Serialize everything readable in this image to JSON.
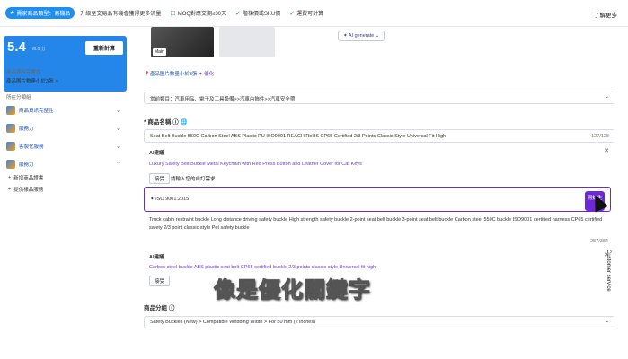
{
  "topbar": {
    "badge": "賣家商品類型：商機品",
    "items": [
      "升級至交易品有機會獲得更多流量",
      "MOQ對應交期≤30天",
      "階梯價或SKU價",
      "運費可計算"
    ],
    "calc_label": "了解更多"
  },
  "sidebar": {
    "score": "5.4",
    "score_sub": "/8.0 分",
    "recalc_label": "重新計算",
    "label1": "商品資料完整性",
    "label2": "產品圖片數量小於3張",
    "section_label": "所在分類組",
    "categories": [
      {
        "label": "商品資訊完整性"
      },
      {
        "label": "服務力"
      },
      {
        "label": "客製化服務"
      },
      {
        "label": "服務力"
      }
    ],
    "subitems": [
      "新增商品證書",
      "提供樣品服務"
    ]
  },
  "main": {
    "img_main_label": "Main",
    "ai_generate_label": "AI generate",
    "image_hint": "產品圖片數量小於3張",
    "image_hint_action": "優化",
    "category_path": "當前類目：汽車用品、電子及工具設備>>汽車內飾件>>汽車安全帶",
    "product_name_label": "* 商品名稱",
    "product_name_value": "Seat Belt Buckle 550C Carbon Steel ABS Plastic PU ISO9001 REACH RoHS CP65 Certified 2/3 Points Classic Style Universal Fit High",
    "product_name_count": "127/128",
    "ai1_title": "AI建議",
    "ai1_text": "Luxury Safety Belt Buckle Metal Keychain with Red Press Button and Leather Cover for Car Keys",
    "accept_label": "接受",
    "custom_label": "請輸入您的自訂需求",
    "input_value": "ISO 9001:2015",
    "start_label": "開始生",
    "keywords_value": "Truck cabin restraint buckle Long distance driving safety buckle High strength safety buckle 2-point seat belt buckle 3-point seat belt buckle Carbon steel 550C buckle ISO9001 certified harness CP65 certified safety 2/3 point classic style Pet safety buckle",
    "keywords_count": "257/384",
    "ai2_title": "AI建議",
    "ai2_text": "Carbon steel buckle ABS plastic seat belt CP65 certified buckle 2/3 points classic style Universal fit high",
    "group_label": "商品分組",
    "group_value": "Safety Buckles (New) > Compatible Webbing Width > For 50 mm (2 inches)",
    "caption": "像是優化關鍵字",
    "customer_service": "Customer service"
  }
}
